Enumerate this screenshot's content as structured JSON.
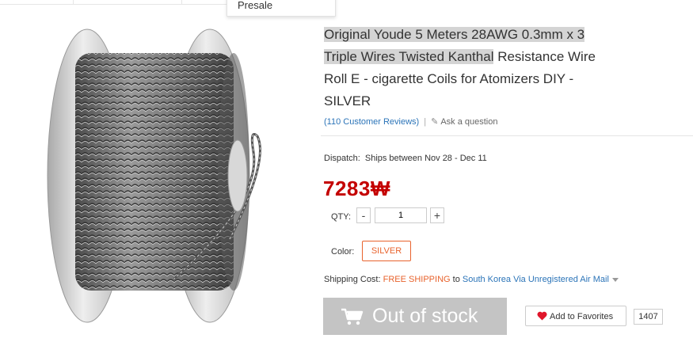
{
  "top_menu": {
    "presale_label": "Presale"
  },
  "product": {
    "title_highlighted_1": "Original Youde 5 Meters 28AWG 0.3mm x 3",
    "title_highlighted_2": "Triple Wires Twisted Kanthal",
    "title_rest_1": " Resistance Wire",
    "title_line_3": "Roll E - cigarette Coils for Atomizers DIY  -",
    "title_line_4": " SILVER",
    "reviews_link": "(110 Customer Reviews)",
    "separator": "|",
    "ask_question": "Ask a question",
    "dispatch_label": "Dispatch:",
    "dispatch_value": "Ships between Nov 28 - Dec 11",
    "price": "7283₩",
    "qty_label": "QTY:",
    "qty_minus": "-",
    "qty_plus": "+",
    "qty_value": "1",
    "color_label": "Color:",
    "color_value": "SILVER",
    "shipping_label": "Shipping Cost:",
    "shipping_free": "FREE SHIPPING",
    "shipping_to": " to ",
    "shipping_dest": "South Korea Via Unregistered Air Mail",
    "out_of_stock_label": "Out of stock",
    "add_to_favorites_label": "Add to Favorites",
    "favorites_count": "1407"
  },
  "colors": {
    "price": "#c40000",
    "accent_orange": "#e8632d",
    "link_blue": "#2b74b8",
    "out_of_stock_bg": "#c4c4c4",
    "heart": "#e0162b"
  },
  "icons": {
    "pencil": "pencil-icon",
    "cart": "cart-icon",
    "heart": "heart-icon",
    "caret": "caret-down-icon"
  }
}
